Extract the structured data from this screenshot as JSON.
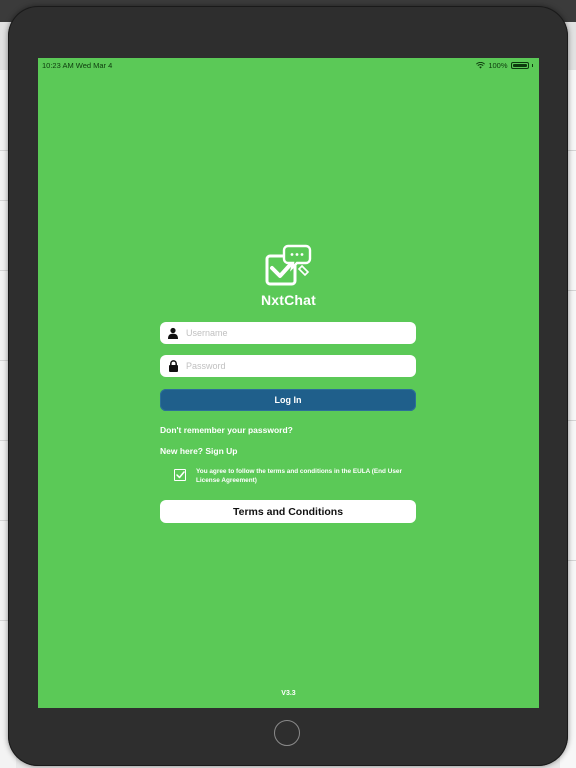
{
  "status_bar": {
    "time_date": "10:23 AM   Wed Mar 4",
    "battery": "100%",
    "battery_level": 1.0
  },
  "app": {
    "title": "NxtChat",
    "logo_icon": "chat-check-logo-icon"
  },
  "login_form": {
    "username_placeholder": "Username",
    "password_placeholder": "Password",
    "login_label": "Log In",
    "forgot_password": "Don't remember your password?",
    "signup": "New here? Sign Up",
    "eula_checked": true,
    "eula_text": "You agree to follow the terms and conditions in the EULA (End User License Agreement)",
    "terms_label": "Terms and Conditions"
  },
  "footer": {
    "version": "V3.3"
  },
  "colors": {
    "screen_background": "#5bc957",
    "login_button": "#1f5f8b",
    "device_frame": "#2e2e2e"
  }
}
